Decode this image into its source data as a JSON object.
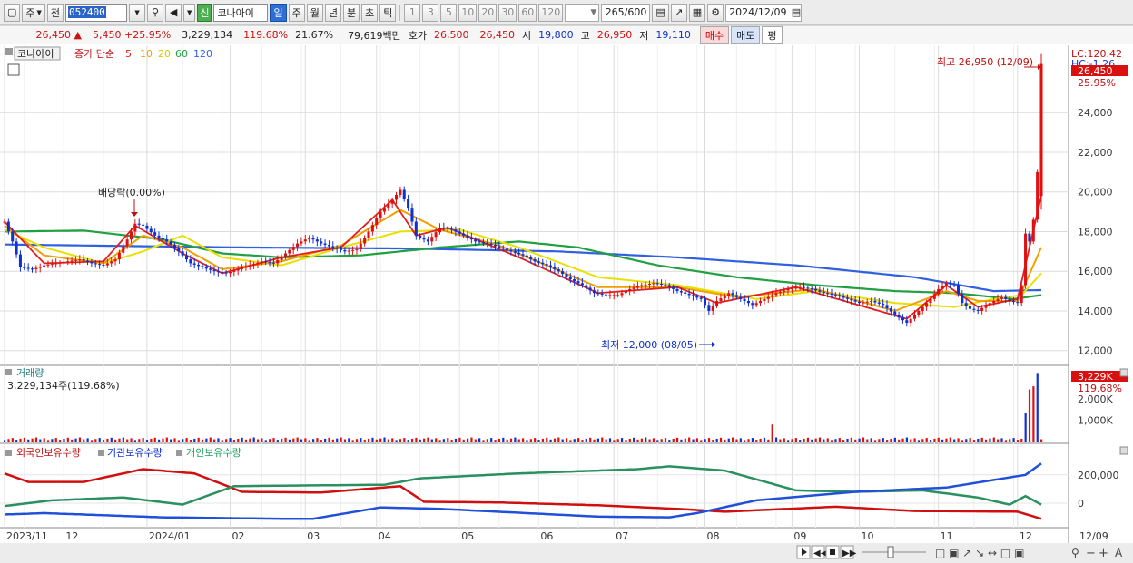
{
  "toolbar": {
    "market": "주",
    "prev": "전",
    "code": "052400",
    "sin_badge": "신",
    "stock_name": "코나아이",
    "periods": [
      "일",
      "주",
      "월",
      "년",
      "분",
      "초",
      "틱"
    ],
    "active_period": "일",
    "numbers": [
      "1",
      "3",
      "5",
      "10",
      "20",
      "30",
      "60",
      "120"
    ],
    "count": "265",
    "count_total": "/600",
    "date": "2024/12/09"
  },
  "quote": {
    "price": "26,450",
    "change": "5,450",
    "change_pct": "+25.95%",
    "volume": "3,229,134",
    "vol_ratio": "119.68%",
    "turnover": "21.67%",
    "amount": "79,619백만",
    "hoga_label": "호가",
    "hoga_ask": "26,500",
    "hoga_bid": "26,450",
    "open_label": "시",
    "open": "19,800",
    "high_label": "고",
    "high": "26,950",
    "low_label": "저",
    "low": "19,110",
    "buy_label": "매수",
    "sell_label": "매도",
    "avg_label": "평"
  },
  "legend": {
    "name": "코나아이",
    "ma_label": "종가 단순",
    "ma_periods": [
      "5",
      "10",
      "20",
      "60",
      "120"
    ],
    "ma_colors": [
      "#e02020",
      "#f0a000",
      "#e8e000",
      "#20a040",
      "#3060e0"
    ]
  },
  "price_panel": {
    "lc_label": "LC:120.42",
    "hc_label": "HC:-1.26",
    "current_price": "26,450",
    "current_pct": "25.95%",
    "high_annotation": "최고 26,950 (12/09)",
    "low_annotation": "최저 12,000 (08/05)",
    "dividend_annotation": "배당락(0.00%)"
  },
  "volume_panel": {
    "title": "거래량",
    "value_text": "3,229,134주(119.68%)",
    "current": "3,229K",
    "current_pct": "119.68%"
  },
  "holdings_panel": {
    "foreign": "외국인보유수량",
    "inst": "기관보유수량",
    "retail": "개인보유수량"
  },
  "nav_icons": [
    "play-icon",
    "first-icon",
    "stop-icon",
    "last-icon"
  ],
  "chart_data": {
    "type": "candlestick",
    "y_ticks": [
      12000,
      14000,
      16000,
      18000,
      20000,
      22000,
      24000
    ],
    "y_range": [
      11300,
      27300
    ],
    "x_labels": [
      {
        "label": "2023/11",
        "d": 0
      },
      {
        "label": "12",
        "d": 15
      },
      {
        "label": "2024/01",
        "d": 36
      },
      {
        "label": "02",
        "d": 57
      },
      {
        "label": "03",
        "d": 76
      },
      {
        "label": "04",
        "d": 94
      },
      {
        "label": "05",
        "d": 115
      },
      {
        "label": "06",
        "d": 135
      },
      {
        "label": "07",
        "d": 154
      },
      {
        "label": "08",
        "d": 177
      },
      {
        "label": "09",
        "d": 199
      },
      {
        "label": "10",
        "d": 216
      },
      {
        "label": "11",
        "d": 236
      },
      {
        "label": "12",
        "d": 256
      },
      {
        "label": "12/09",
        "d": 262
      }
    ],
    "close_path": [
      [
        0,
        18500
      ],
      [
        2,
        17500
      ],
      [
        4,
        16200
      ],
      [
        7,
        16100
      ],
      [
        10,
        16300
      ],
      [
        13,
        16400
      ],
      [
        16,
        16500
      ],
      [
        19,
        16600
      ],
      [
        22,
        16400
      ],
      [
        25,
        16300
      ],
      [
        28,
        16600
      ],
      [
        31,
        17600
      ],
      [
        33,
        18400
      ],
      [
        35,
        18300
      ],
      [
        38,
        17800
      ],
      [
        41,
        17500
      ],
      [
        44,
        17000
      ],
      [
        47,
        16400
      ],
      [
        50,
        16200
      ],
      [
        53,
        16000
      ],
      [
        56,
        15900
      ],
      [
        59,
        16100
      ],
      [
        62,
        16300
      ],
      [
        65,
        16500
      ],
      [
        68,
        16400
      ],
      [
        71,
        16900
      ],
      [
        74,
        17400
      ],
      [
        77,
        17700
      ],
      [
        80,
        17400
      ],
      [
        83,
        17200
      ],
      [
        86,
        17000
      ],
      [
        89,
        17100
      ],
      [
        92,
        18000
      ],
      [
        95,
        19000
      ],
      [
        98,
        19600
      ],
      [
        100,
        20100
      ],
      [
        102,
        19200
      ],
      [
        104,
        17800
      ],
      [
        107,
        17500
      ],
      [
        110,
        18200
      ],
      [
        113,
        18100
      ],
      [
        116,
        17800
      ],
      [
        119,
        17500
      ],
      [
        122,
        17400
      ],
      [
        125,
        17200
      ],
      [
        128,
        17000
      ],
      [
        131,
        16800
      ],
      [
        134,
        16500
      ],
      [
        137,
        16300
      ],
      [
        140,
        16000
      ],
      [
        143,
        15600
      ],
      [
        146,
        15300
      ],
      [
        149,
        14900
      ],
      [
        152,
        14800
      ],
      [
        155,
        14800
      ],
      [
        158,
        15100
      ],
      [
        161,
        15300
      ],
      [
        164,
        15400
      ],
      [
        167,
        15300
      ],
      [
        170,
        15000
      ],
      [
        173,
        14800
      ],
      [
        176,
        14600
      ],
      [
        178,
        14000
      ],
      [
        180,
        14500
      ],
      [
        183,
        14900
      ],
      [
        186,
        14600
      ],
      [
        189,
        14300
      ],
      [
        192,
        14600
      ],
      [
        195,
        14900
      ],
      [
        198,
        15100
      ],
      [
        201,
        15200
      ],
      [
        204,
        15100
      ],
      [
        207,
        14900
      ],
      [
        210,
        14800
      ],
      [
        213,
        14600
      ],
      [
        216,
        14400
      ],
      [
        219,
        14500
      ],
      [
        222,
        14300
      ],
      [
        225,
        13800
      ],
      [
        228,
        13400
      ],
      [
        231,
        14000
      ],
      [
        234,
        14600
      ],
      [
        236,
        15100
      ],
      [
        238,
        15400
      ],
      [
        240,
        15300
      ],
      [
        242,
        14400
      ],
      [
        244,
        14100
      ],
      [
        246,
        14000
      ],
      [
        248,
        14300
      ],
      [
        250,
        14500
      ],
      [
        252,
        14700
      ],
      [
        254,
        14500
      ],
      [
        256,
        14400
      ],
      [
        257,
        15300
      ],
      [
        258,
        17900
      ],
      [
        259,
        17500
      ],
      [
        260,
        18600
      ],
      [
        261,
        21000
      ],
      [
        262,
        26450
      ]
    ],
    "ma_paths": {
      "ma120": [
        [
          0,
          17350
        ],
        [
          20,
          17300
        ],
        [
          60,
          17200
        ],
        [
          100,
          17150
        ],
        [
          140,
          17000
        ],
        [
          170,
          16700
        ],
        [
          200,
          16300
        ],
        [
          230,
          15700
        ],
        [
          250,
          15000
        ],
        [
          262,
          15050
        ]
      ],
      "ma60": [
        [
          0,
          18000
        ],
        [
          20,
          18050
        ],
        [
          40,
          17600
        ],
        [
          55,
          16900
        ],
        [
          70,
          16700
        ],
        [
          90,
          16800
        ],
        [
          110,
          17200
        ],
        [
          130,
          17500
        ],
        [
          145,
          17200
        ],
        [
          165,
          16300
        ],
        [
          185,
          15700
        ],
        [
          205,
          15300
        ],
        [
          225,
          15000
        ],
        [
          240,
          14900
        ],
        [
          255,
          14600
        ],
        [
          262,
          14800
        ]
      ],
      "ma20": [
        [
          0,
          18100
        ],
        [
          10,
          17200
        ],
        [
          25,
          16400
        ],
        [
          35,
          17000
        ],
        [
          45,
          17800
        ],
        [
          55,
          16700
        ],
        [
          70,
          16300
        ],
        [
          85,
          17200
        ],
        [
          100,
          18000
        ],
        [
          115,
          18100
        ],
        [
          130,
          17200
        ],
        [
          150,
          15700
        ],
        [
          170,
          15300
        ],
        [
          190,
          14600
        ],
        [
          205,
          15000
        ],
        [
          225,
          14400
        ],
        [
          240,
          14200
        ],
        [
          250,
          14600
        ],
        [
          257,
          14800
        ],
        [
          262,
          15900
        ]
      ],
      "ma10": [
        [
          0,
          18300
        ],
        [
          10,
          16800
        ],
        [
          25,
          16400
        ],
        [
          35,
          17800
        ],
        [
          45,
          17200
        ],
        [
          55,
          16100
        ],
        [
          70,
          16500
        ],
        [
          85,
          17300
        ],
        [
          100,
          19100
        ],
        [
          110,
          18100
        ],
        [
          125,
          17300
        ],
        [
          150,
          15200
        ],
        [
          170,
          15200
        ],
        [
          185,
          14700
        ],
        [
          205,
          15100
        ],
        [
          225,
          14000
        ],
        [
          238,
          15000
        ],
        [
          246,
          14500
        ],
        [
          256,
          14500
        ],
        [
          262,
          17200
        ]
      ],
      "ma5": [
        [
          0,
          18500
        ],
        [
          10,
          16400
        ],
        [
          25,
          16500
        ],
        [
          33,
          18300
        ],
        [
          45,
          16900
        ],
        [
          55,
          15900
        ],
        [
          70,
          16700
        ],
        [
          85,
          17200
        ],
        [
          98,
          19600
        ],
        [
          104,
          17800
        ],
        [
          112,
          18200
        ],
        [
          130,
          16700
        ],
        [
          150,
          14900
        ],
        [
          170,
          15200
        ],
        [
          180,
          14400
        ],
        [
          200,
          15200
        ],
        [
          228,
          13600
        ],
        [
          238,
          15300
        ],
        [
          246,
          14200
        ],
        [
          256,
          14600
        ],
        [
          262,
          19800
        ]
      ]
    },
    "volume_spikes": [
      [
        194,
        800000
      ],
      [
        258,
        1350000
      ],
      [
        259,
        2450000
      ],
      [
        260,
        2600000
      ],
      [
        261,
        3229134
      ]
    ],
    "volume_ticks": [
      1000000,
      2000000
    ],
    "holdings": {
      "ticks": [
        200000,
        0
      ],
      "foreign": [
        [
          0,
          210000
        ],
        [
          6,
          150000
        ],
        [
          20,
          150000
        ],
        [
          35,
          240000
        ],
        [
          48,
          210000
        ],
        [
          60,
          80000
        ],
        [
          80,
          75000
        ],
        [
          100,
          120000
        ],
        [
          106,
          10000
        ],
        [
          125,
          5000
        ],
        [
          150,
          -15000
        ],
        [
          170,
          -40000
        ],
        [
          182,
          -60000
        ],
        [
          210,
          -25000
        ],
        [
          230,
          -55000
        ],
        [
          256,
          -60000
        ],
        [
          262,
          -110000
        ]
      ],
      "inst": [
        [
          0,
          -20000
        ],
        [
          12,
          20000
        ],
        [
          30,
          40000
        ],
        [
          45,
          -10000
        ],
        [
          58,
          120000
        ],
        [
          76,
          125000
        ],
        [
          96,
          130000
        ],
        [
          105,
          175000
        ],
        [
          130,
          210000
        ],
        [
          160,
          240000
        ],
        [
          168,
          260000
        ],
        [
          182,
          230000
        ],
        [
          200,
          90000
        ],
        [
          215,
          80000
        ],
        [
          232,
          90000
        ],
        [
          246,
          40000
        ],
        [
          254,
          -10000
        ],
        [
          258,
          50000
        ],
        [
          262,
          -10000
        ]
      ],
      "retail": [
        [
          0,
          -80000
        ],
        [
          10,
          -70000
        ],
        [
          40,
          -100000
        ],
        [
          70,
          -110000
        ],
        [
          78,
          -110000
        ],
        [
          95,
          -30000
        ],
        [
          110,
          -40000
        ],
        [
          150,
          -95000
        ],
        [
          168,
          -100000
        ],
        [
          175,
          -70000
        ],
        [
          190,
          20000
        ],
        [
          215,
          80000
        ],
        [
          238,
          110000
        ],
        [
          258,
          200000
        ],
        [
          262,
          280000
        ]
      ]
    }
  }
}
